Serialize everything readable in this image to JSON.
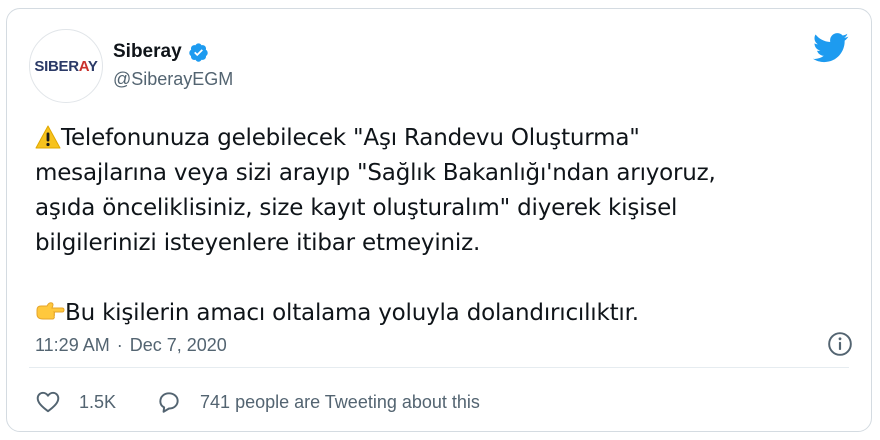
{
  "tweet": {
    "avatar": {
      "text_main": "SIBER",
      "text_accent": "A",
      "text_end": "Y"
    },
    "author": {
      "display_name": "Siberay",
      "handle": "@SiberayEGM"
    },
    "text_lines_para1": [
      "Telefonunuza gelebilecek \"Aşı Randevu Oluşturma\"",
      "mesajlarına veya sizi arayıp \"Sağlık Bakanlığı'ndan arıyoruz,",
      "aşıda önceliklisiniz, size kayıt oluşturalım\" diyerek kişisel",
      "bilgilerinizi isteyenlere itibar etmeyiniz."
    ],
    "text_para2": "Bu kişilerin amacı oltalama yoluyla dolandırıcılıktır.",
    "emoji_para1": "warning-emoji",
    "emoji_para2": "pointing-right-emoji",
    "time": "11:29 AM",
    "separator": "·",
    "date": "Dec 7, 2020",
    "likes": "1.5K",
    "reply_text": "741 people are Tweeting about this"
  },
  "colors": {
    "twitter_blue": "#1d9bf0",
    "muted_text": "#536471",
    "body_text": "#0f1419",
    "border": "#d4dbe1",
    "warning_yellow": "#f7c21d",
    "hand_yellow": "#ffc83d"
  },
  "icons": [
    "verified-badge-icon",
    "twitter-bird-icon",
    "info-icon",
    "heart-icon",
    "reply-icon"
  ]
}
